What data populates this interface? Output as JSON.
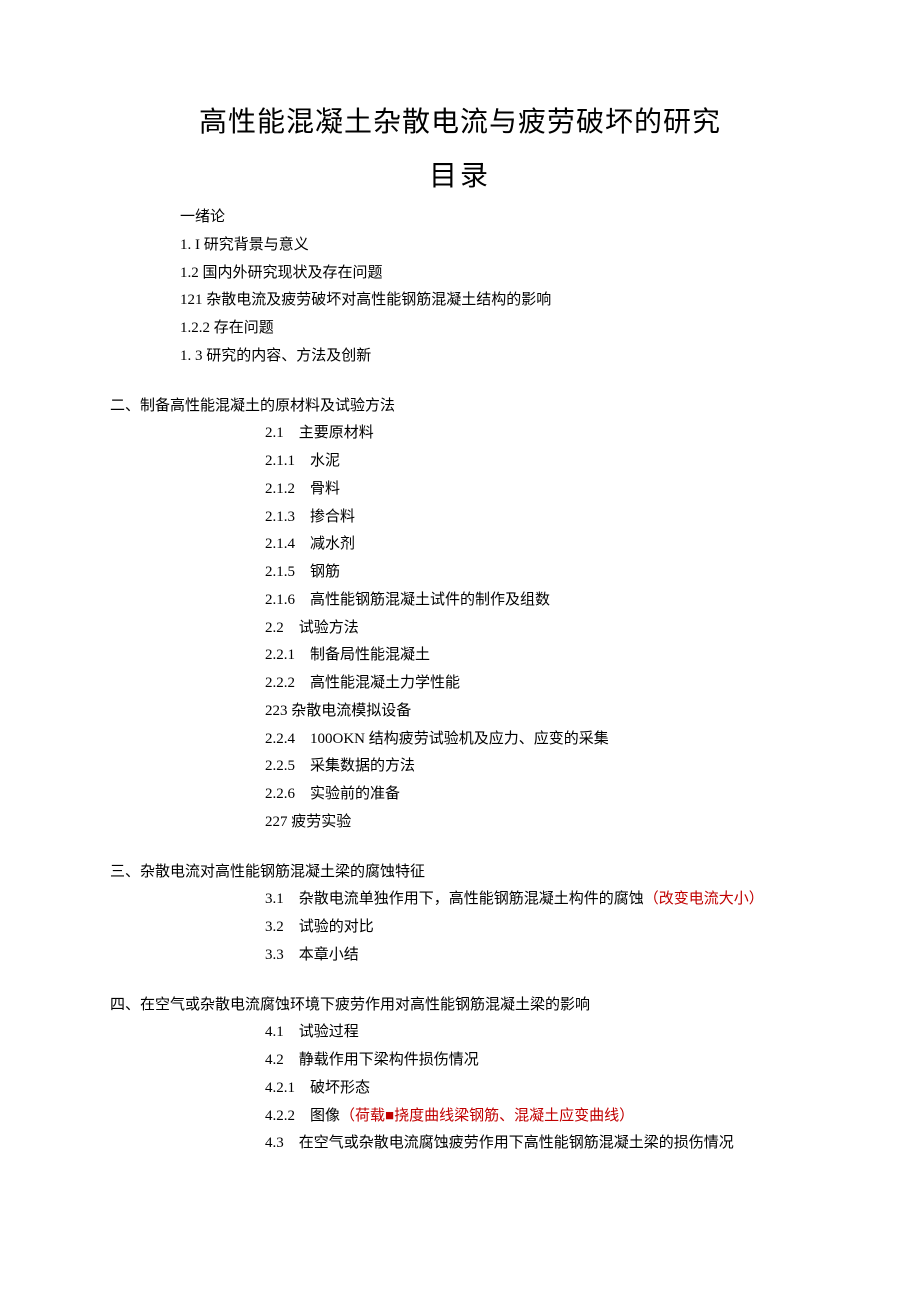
{
  "title": "高性能混凝土杂散电流与疲劳破坏的研究",
  "toc_title": "目录",
  "s1": {
    "h": "一绪论",
    "i1": "1. I 研究背景与意义",
    "i2": "1.2 国内外研究现状及存在问题",
    "i3": "121 杂散电流及疲劳破坏对高性能钢筋混凝土结构的影响",
    "i4": "1.2.2 存在问题",
    "i5": "1. 3 研究的内容、方法及创新"
  },
  "s2": {
    "h": "二、制备高性能混凝土的原材料及试验方法",
    "i1": "2.1    主要原材料",
    "i2": "2.1.1    水泥",
    "i3": "2.1.2    骨料",
    "i4": "2.1.3    掺合料",
    "i5": "2.1.4    减水剂",
    "i6": "2.1.5    钢筋",
    "i7": "2.1.6    高性能钢筋混凝土试件的制作及组数",
    "i8": "2.2    试验方法",
    "i9": "2.2.1    制备局性能混凝土",
    "i10": "2.2.2    高性能混凝土力学性能",
    "i11": "223 杂散电流模拟设备",
    "i12": "2.2.4    100OKN 结构疲劳试验机及应力、应变的采集",
    "i13": "2.2.5    采集数据的方法",
    "i14": "2.2.6    实验前的准备",
    "i15": "227 疲劳实验"
  },
  "s3": {
    "h": "三、杂散电流对高性能钢筋混凝土梁的腐蚀特征",
    "i1": "3.1    杂散电流单独作用下，高性能钢筋混凝土构件的腐蚀",
    "i1_red": "（改变电流大小）",
    "i2": "3.2    试验的对比",
    "i3": "3.3    本章小结"
  },
  "s4": {
    "h": "四、在空气或杂散电流腐蚀环境下疲劳作用对高性能钢筋混凝土梁的影响",
    "i1": "4.1    试验过程",
    "i2": "4.2    静载作用下梁构件损伤情况",
    "i3": "4.2.1    破坏形态",
    "i4a": "4.2.2    图像",
    "i4b_red": "（荷载■挠度曲线梁钢筋、混凝土应变曲线）",
    "i5": "4.3    在空气或杂散电流腐蚀疲劳作用下高性能钢筋混凝土梁的损伤情况"
  }
}
